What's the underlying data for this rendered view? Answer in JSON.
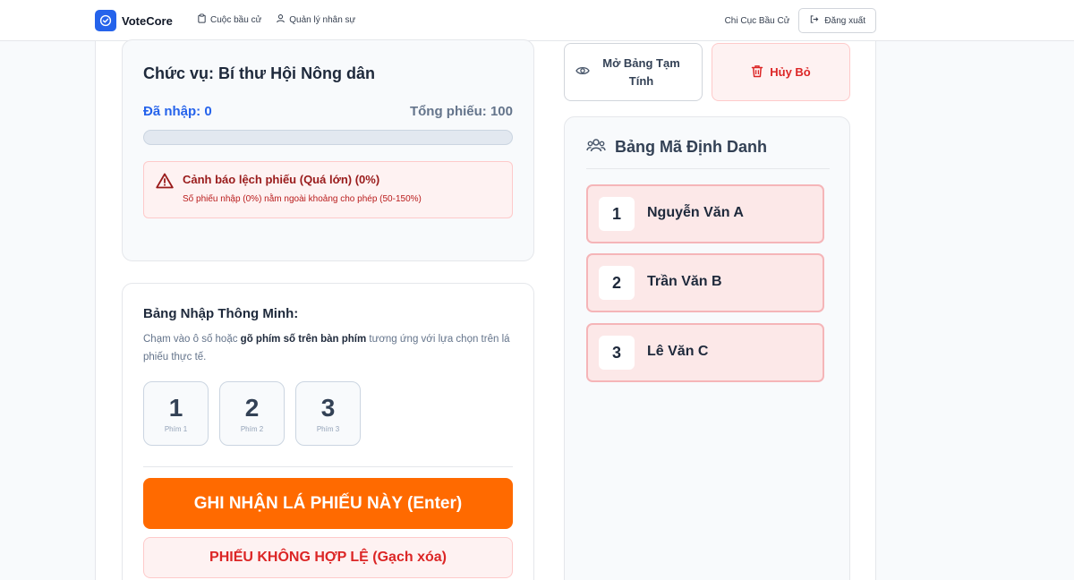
{
  "app": {
    "name": "VoteCore"
  },
  "nav": {
    "items": [
      {
        "label": "Cuộc bầu cử",
        "icon": "clipboard-icon"
      },
      {
        "label": "Quản lý nhân sự",
        "icon": "users-icon"
      }
    ]
  },
  "header": {
    "org": "Chi Cục Bầu Cử",
    "logout_label": "Đăng xuất"
  },
  "position": {
    "title": "Chức vụ: Bí thư Hội Nông dân",
    "entered_label": "Đã nhập: 0",
    "total_label": "Tổng phiếu: 100",
    "progress_fraction": 0
  },
  "warning": {
    "title": "Cảnh báo lệch phiếu (Quá lớn) (0%)",
    "description": "Số phiếu nhập (0%) nằm ngoài khoảng cho phép (50-150%)"
  },
  "smart_input": {
    "title": "Bảng Nhập Thông Minh:",
    "desc_before": "Chạm vào ô số hoặc ",
    "desc_bold": "gõ phím số trên bàn phím",
    "desc_after": " tương ứng với lựa chọn trên lá phiếu thực tế.",
    "keys": [
      {
        "number": "1",
        "label": "Phím 1"
      },
      {
        "number": "2",
        "label": "Phím 2"
      },
      {
        "number": "3",
        "label": "Phím 3"
      }
    ],
    "submit_label": "GHI NHẬN LÁ PHIẾU NÀY (Enter)",
    "invalid_label": "PHIẾU KHÔNG HỢP LỆ (Gạch xóa)"
  },
  "actions": {
    "preview_line1": "Mở Bảng Tạm",
    "preview_line2": "Tính",
    "cancel_label": "Hủy Bỏ"
  },
  "id_table": {
    "title": "Bảng Mã Định Danh",
    "candidates": [
      {
        "number": "1",
        "name": "Nguyễn Văn A"
      },
      {
        "number": "2",
        "name": "Trần Văn B"
      },
      {
        "number": "3",
        "name": "Lê Văn C"
      }
    ]
  },
  "colors": {
    "brand": "#2563eb",
    "accent": "#ff6a00",
    "danger": "#dc2626"
  }
}
